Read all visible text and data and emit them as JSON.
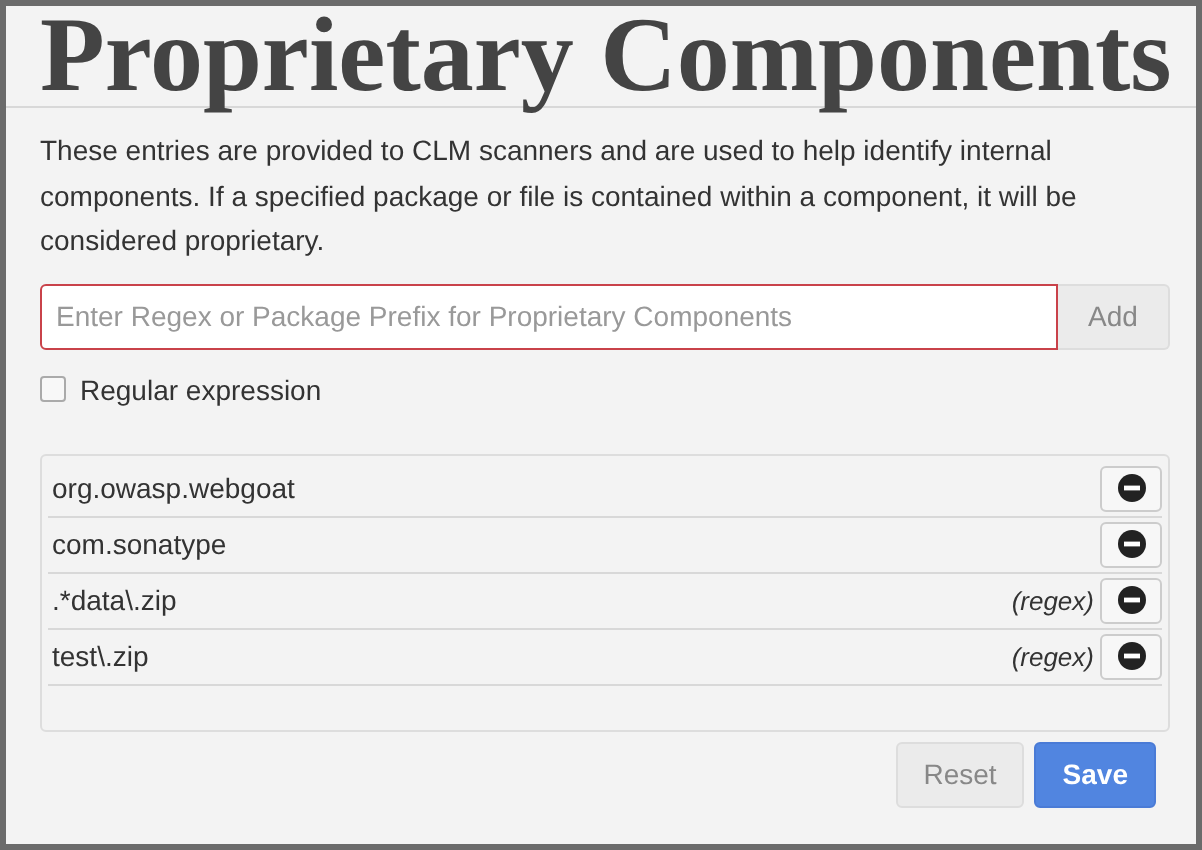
{
  "title": "Proprietary Components",
  "description": "These entries are provided to CLM scanners and are used to help identify internal components. If a specified package or file is contained within a component, it will be considered proprietary.",
  "entry_field": {
    "placeholder": "Enter Regex or Package Prefix for Proprietary Components",
    "invalid": true
  },
  "add_button": {
    "label": "Add",
    "disabled": true
  },
  "regex_option": {
    "label": "Regular expression",
    "checked": false
  },
  "entries": [
    {
      "value": "org.owasp.webgoat"
    },
    {
      "value": "com.sonatype"
    },
    {
      "value": ".*data\\.zip",
      "tag": "(regex)"
    },
    {
      "value": "test\\.zip",
      "tag": "(regex)"
    }
  ],
  "buttons": [
    {
      "label": "Reset",
      "kind": "secondary",
      "disabled": true
    },
    {
      "label": "Save",
      "kind": "primary",
      "disabled": false
    }
  ]
}
